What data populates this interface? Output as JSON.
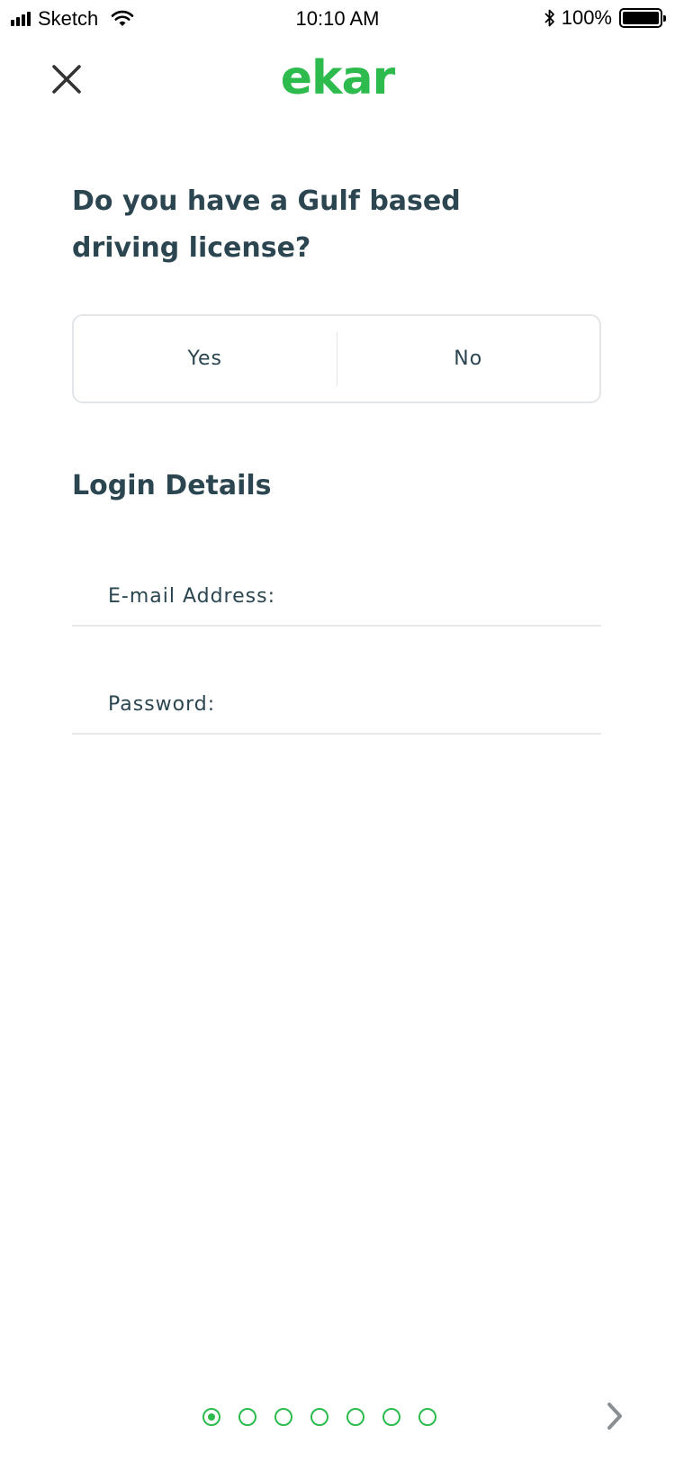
{
  "status_bar": {
    "carrier": "Sketch",
    "time": "10:10 AM",
    "battery": "100%",
    "icons": [
      "signal-icon",
      "wifi-icon",
      "bluetooth-icon",
      "battery-icon"
    ]
  },
  "header": {
    "logo": "ekar",
    "close_icon": "close-icon"
  },
  "question": {
    "text": "Do you have a Gulf based driving license?",
    "options": [
      "Yes",
      "No"
    ]
  },
  "login": {
    "title": "Login Details",
    "email_label": "E-mail Address:",
    "password_label": "Password:"
  },
  "pager": {
    "total": 7,
    "current": 1,
    "next_icon": "chevron-right-icon"
  },
  "colors": {
    "brand_green": "#2dbb4d",
    "text_dark": "#2b4650",
    "border": "#e3e6e8"
  }
}
